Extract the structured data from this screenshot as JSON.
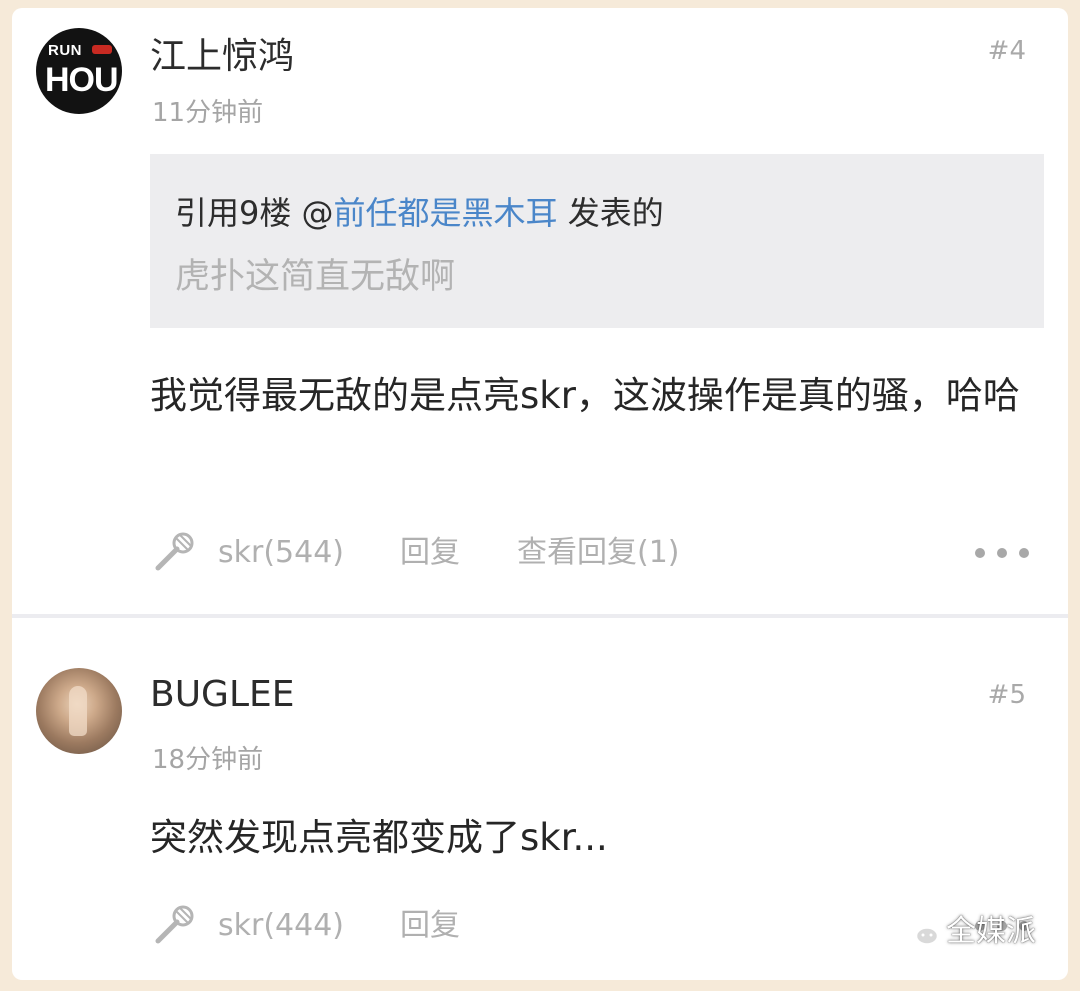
{
  "posts": [
    {
      "username": "江上惊鸿",
      "floor": "#4",
      "time": "11分钟前",
      "avatar_text_top": "RUN",
      "avatar_text_main": "HOU",
      "quote": {
        "prefix": "引用9楼 @",
        "user": "前任都是黑木耳",
        "suffix": " 发表的",
        "text": "虎扑这简直无敌啊"
      },
      "content": "我觉得最无敌的是点亮skr，这波操作是真的骚，哈哈",
      "like_label": "skr(544)",
      "reply_label": "回复",
      "view_replies_label": "查看回复(1)",
      "more_icon": "more-dots-icon"
    },
    {
      "username": "BUGLEE",
      "floor": "#5",
      "time": "18分钟前",
      "content": "突然发现点亮都变成了skr...",
      "like_label": "skr(444)",
      "reply_label": "回复",
      "more_icon": "more-dots-icon"
    }
  ],
  "watermark": {
    "text": "全媒派",
    "icon": "wechat-icon"
  },
  "colors": {
    "background": "#f6ead9",
    "card": "#ffffff",
    "quote_background": "#ededef",
    "link": "#4a86c9",
    "muted_text": "#a5a5a5"
  }
}
